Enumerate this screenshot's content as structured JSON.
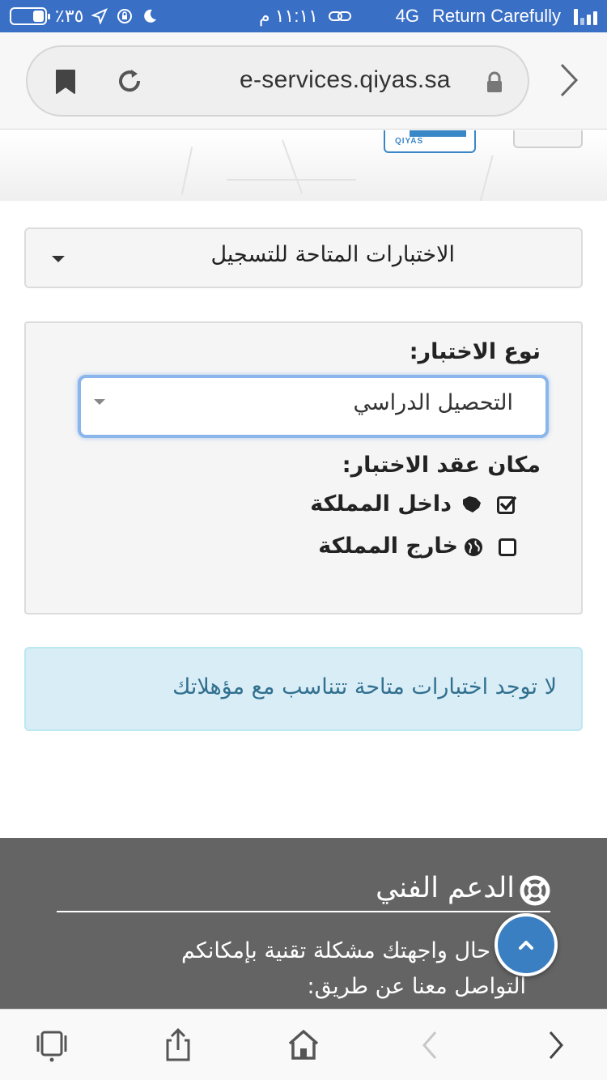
{
  "status_bar": {
    "battery_percent": "٪٣٥",
    "battery_level": 0.35,
    "time": "١١:١١ م",
    "network": "4G",
    "carrier": "Return Carefully"
  },
  "browser": {
    "url": "e-services.qiyas.sa"
  },
  "header": {
    "logo_text": "QIYAS"
  },
  "tests_dropdown": {
    "label": "الاختبارات المتاحة للتسجيل"
  },
  "filters": {
    "test_type_label": "نوع الاختبار:",
    "test_type_value": "التحصيل الدراسي",
    "location_label": "مكان عقد الاختبار:",
    "options": [
      {
        "label": "داخل المملكة",
        "checked": true
      },
      {
        "label": "خارج المملكة",
        "checked": false
      }
    ]
  },
  "alert": {
    "message": "لا توجد اختبارات متاحة تتناسب مع مؤهلاتك"
  },
  "footer": {
    "support_title": "الدعم الفني",
    "support_line1": "في حال واجهتك مشكلة تقنية بإمكانكم",
    "support_line2": "التواصل معنا عن طريق:"
  },
  "colors": {
    "status_bar": "#3a6fc6",
    "alert_bg": "#d9edf7",
    "alert_text": "#31708f",
    "footer_bg": "#646464",
    "accent": "#3a7fc2"
  }
}
